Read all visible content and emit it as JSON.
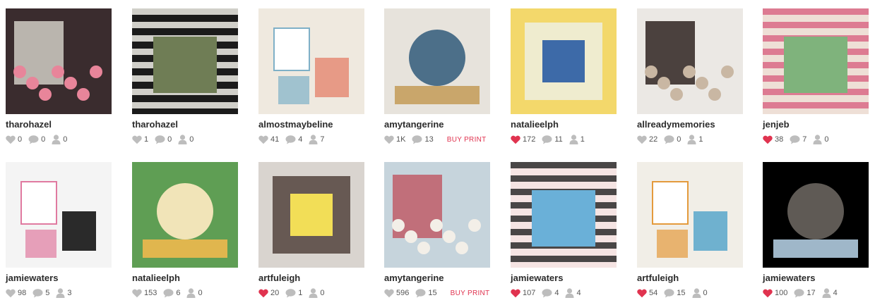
{
  "colors": {
    "heart_liked": "#e0334f",
    "icon_gray": "#bdbdbd",
    "buy_print": "#e0334f"
  },
  "icons": {
    "likes": "heart-icon",
    "comments": "comment-bubble-icon",
    "followers": "user-icon"
  },
  "posts": [
    {
      "user": "tharohazel",
      "likes": "0",
      "comments": "0",
      "followers": "0",
      "liked": false,
      "buy_print": "",
      "thumb_colors": [
        "#3a2c2e",
        "#e8859a",
        "#c9c4bd"
      ]
    },
    {
      "user": "tharohazel",
      "likes": "1",
      "comments": "0",
      "followers": "0",
      "liked": false,
      "buy_print": "",
      "thumb_colors": [
        "#1b1b1b",
        "#f0efe8",
        "#6f7d55"
      ]
    },
    {
      "user": "almostmaybeline",
      "likes": "41",
      "comments": "4",
      "followers": "7",
      "liked": false,
      "buy_print": "",
      "thumb_colors": [
        "#efe9df",
        "#e79a86",
        "#7fb0c7"
      ]
    },
    {
      "user": "amytangerine",
      "likes": "1K",
      "comments": "13",
      "followers": "",
      "liked": false,
      "buy_print": "BUY PRINT",
      "thumb_colors": [
        "#e7e3dc",
        "#4c6f89",
        "#c9a66b"
      ]
    },
    {
      "user": "natalieelph",
      "likes": "172",
      "comments": "11",
      "followers": "1",
      "liked": true,
      "buy_print": "",
      "thumb_colors": [
        "#f3d86b",
        "#eef1e8",
        "#3d6aa8"
      ]
    },
    {
      "user": "allreadymemories",
      "likes": "22",
      "comments": "0",
      "followers": "1",
      "liked": false,
      "buy_print": "",
      "thumb_colors": [
        "#ebe8e4",
        "#c9b7a3",
        "#3a2f2b"
      ]
    },
    {
      "user": "jenjeb",
      "likes": "38",
      "comments": "7",
      "followers": "0",
      "liked": true,
      "buy_print": "",
      "thumb_colors": [
        "#eedfd6",
        "#d96a86",
        "#7fb37c"
      ]
    },
    {
      "user": "jamiewaters",
      "likes": "98",
      "comments": "5",
      "followers": "3",
      "liked": false,
      "buy_print": "",
      "thumb_colors": [
        "#f4f4f4",
        "#2a2a2a",
        "#e07aa0"
      ]
    },
    {
      "user": "natalieelph",
      "likes": "153",
      "comments": "6",
      "followers": "0",
      "liked": false,
      "buy_print": "",
      "thumb_colors": [
        "#5f9e54",
        "#f1e4b8",
        "#e0b64e"
      ]
    },
    {
      "user": "artfuleigh",
      "likes": "20",
      "comments": "1",
      "followers": "0",
      "liked": true,
      "buy_print": "",
      "thumb_colors": [
        "#d9d4cf",
        "#4a3a33",
        "#f2de57"
      ]
    },
    {
      "user": "amytangerine",
      "likes": "596",
      "comments": "15",
      "followers": "",
      "liked": false,
      "buy_print": "BUY PRINT",
      "thumb_colors": [
        "#c6d4dc",
        "#f3efe8",
        "#c0646f"
      ]
    },
    {
      "user": "jamiewaters",
      "likes": "107",
      "comments": "4",
      "followers": "4",
      "liked": true,
      "buy_print": "",
      "thumb_colors": [
        "#f5e4e3",
        "#2a2a2a",
        "#6ab0d8"
      ]
    },
    {
      "user": "artfuleigh",
      "likes": "54",
      "comments": "15",
      "followers": "0",
      "liked": true,
      "buy_print": "",
      "thumb_colors": [
        "#f1eee7",
        "#6fb1cf",
        "#e49a3c"
      ]
    },
    {
      "user": "jamiewaters",
      "likes": "100",
      "comments": "17",
      "followers": "4",
      "liked": true,
      "buy_print": "",
      "thumb_colors": [
        "#000000",
        "#5f5a55",
        "#9fb7c9"
      ]
    }
  ]
}
